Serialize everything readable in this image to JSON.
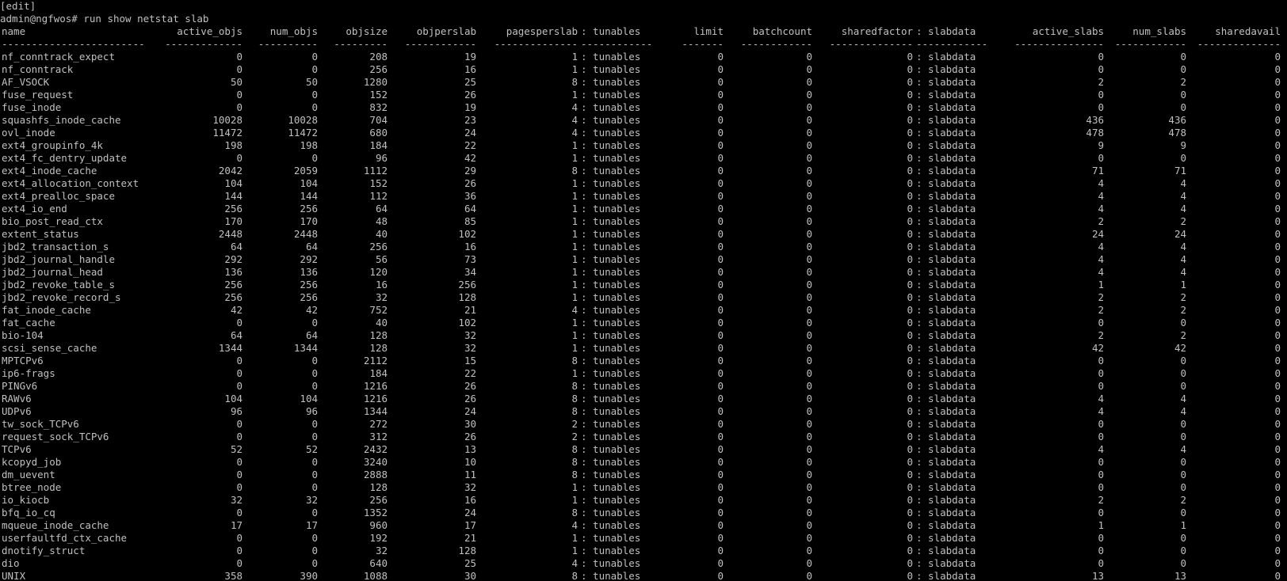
{
  "terminal": {
    "edit_line": "[edit]",
    "prompt": "admin@ngfwos#",
    "command": "run show netstat slab"
  },
  "table": {
    "headers": {
      "name": "name",
      "active_objs": "active_objs",
      "num_objs": "num_objs",
      "objsize": "objsize",
      "objperslab": "objperslab",
      "pagesperslab": "pagesperslab",
      "tunables": ": tunables",
      "limit": "limit",
      "batchcount": "batchcount",
      "sharedfactor": "sharedfactor",
      "slabdata": ": slabdata",
      "active_slabs": "active_slabs",
      "num_slabs": "num_slabs",
      "sharedavail": "sharedavail"
    },
    "separators": {
      "name": "------------------------",
      "active_objs": "-------------",
      "num_objs": "----------",
      "objsize": "---------",
      "objperslab": "------------",
      "pagesperslab": "--------------",
      "tunables": "------------",
      "limit": "-------",
      "batchcount": "------------",
      "sharedfactor": "--------------",
      "slabdata": "------------",
      "active_slabs": "---------------",
      "num_slabs": "------------",
      "sharedavail": "--------------"
    },
    "rows": [
      {
        "name": "nf_conntrack_expect",
        "active_objs": "0",
        "num_objs": "0",
        "objsize": "208",
        "objperslab": "19",
        "pagesperslab": "1",
        "tunables": ": tunables",
        "limit": "0",
        "batchcount": "0",
        "sharedfactor": "0",
        "slabdata": ": slabdata",
        "active_slabs": "0",
        "num_slabs": "0",
        "sharedavail": "0"
      },
      {
        "name": "nf_conntrack",
        "active_objs": "0",
        "num_objs": "0",
        "objsize": "256",
        "objperslab": "16",
        "pagesperslab": "1",
        "tunables": ": tunables",
        "limit": "0",
        "batchcount": "0",
        "sharedfactor": "0",
        "slabdata": ": slabdata",
        "active_slabs": "0",
        "num_slabs": "0",
        "sharedavail": "0"
      },
      {
        "name": "AF_VSOCK",
        "active_objs": "50",
        "num_objs": "50",
        "objsize": "1280",
        "objperslab": "25",
        "pagesperslab": "8",
        "tunables": ": tunables",
        "limit": "0",
        "batchcount": "0",
        "sharedfactor": "0",
        "slabdata": ": slabdata",
        "active_slabs": "2",
        "num_slabs": "2",
        "sharedavail": "0"
      },
      {
        "name": "fuse_request",
        "active_objs": "0",
        "num_objs": "0",
        "objsize": "152",
        "objperslab": "26",
        "pagesperslab": "1",
        "tunables": ": tunables",
        "limit": "0",
        "batchcount": "0",
        "sharedfactor": "0",
        "slabdata": ": slabdata",
        "active_slabs": "0",
        "num_slabs": "0",
        "sharedavail": "0"
      },
      {
        "name": "fuse_inode",
        "active_objs": "0",
        "num_objs": "0",
        "objsize": "832",
        "objperslab": "19",
        "pagesperslab": "4",
        "tunables": ": tunables",
        "limit": "0",
        "batchcount": "0",
        "sharedfactor": "0",
        "slabdata": ": slabdata",
        "active_slabs": "0",
        "num_slabs": "0",
        "sharedavail": "0"
      },
      {
        "name": "squashfs_inode_cache",
        "active_objs": "10028",
        "num_objs": "10028",
        "objsize": "704",
        "objperslab": "23",
        "pagesperslab": "4",
        "tunables": ": tunables",
        "limit": "0",
        "batchcount": "0",
        "sharedfactor": "0",
        "slabdata": ": slabdata",
        "active_slabs": "436",
        "num_slabs": "436",
        "sharedavail": "0"
      },
      {
        "name": "ovl_inode",
        "active_objs": "11472",
        "num_objs": "11472",
        "objsize": "680",
        "objperslab": "24",
        "pagesperslab": "4",
        "tunables": ": tunables",
        "limit": "0",
        "batchcount": "0",
        "sharedfactor": "0",
        "slabdata": ": slabdata",
        "active_slabs": "478",
        "num_slabs": "478",
        "sharedavail": "0"
      },
      {
        "name": "ext4_groupinfo_4k",
        "active_objs": "198",
        "num_objs": "198",
        "objsize": "184",
        "objperslab": "22",
        "pagesperslab": "1",
        "tunables": ": tunables",
        "limit": "0",
        "batchcount": "0",
        "sharedfactor": "0",
        "slabdata": ": slabdata",
        "active_slabs": "9",
        "num_slabs": "9",
        "sharedavail": "0"
      },
      {
        "name": "ext4_fc_dentry_update",
        "active_objs": "0",
        "num_objs": "0",
        "objsize": "96",
        "objperslab": "42",
        "pagesperslab": "1",
        "tunables": ": tunables",
        "limit": "0",
        "batchcount": "0",
        "sharedfactor": "0",
        "slabdata": ": slabdata",
        "active_slabs": "0",
        "num_slabs": "0",
        "sharedavail": "0"
      },
      {
        "name": "ext4_inode_cache",
        "active_objs": "2042",
        "num_objs": "2059",
        "objsize": "1112",
        "objperslab": "29",
        "pagesperslab": "8",
        "tunables": ": tunables",
        "limit": "0",
        "batchcount": "0",
        "sharedfactor": "0",
        "slabdata": ": slabdata",
        "active_slabs": "71",
        "num_slabs": "71",
        "sharedavail": "0"
      },
      {
        "name": "ext4_allocation_context",
        "active_objs": "104",
        "num_objs": "104",
        "objsize": "152",
        "objperslab": "26",
        "pagesperslab": "1",
        "tunables": ": tunables",
        "limit": "0",
        "batchcount": "0",
        "sharedfactor": "0",
        "slabdata": ": slabdata",
        "active_slabs": "4",
        "num_slabs": "4",
        "sharedavail": "0"
      },
      {
        "name": "ext4_prealloc_space",
        "active_objs": "144",
        "num_objs": "144",
        "objsize": "112",
        "objperslab": "36",
        "pagesperslab": "1",
        "tunables": ": tunables",
        "limit": "0",
        "batchcount": "0",
        "sharedfactor": "0",
        "slabdata": ": slabdata",
        "active_slabs": "4",
        "num_slabs": "4",
        "sharedavail": "0"
      },
      {
        "name": "ext4_io_end",
        "active_objs": "256",
        "num_objs": "256",
        "objsize": "64",
        "objperslab": "64",
        "pagesperslab": "1",
        "tunables": ": tunables",
        "limit": "0",
        "batchcount": "0",
        "sharedfactor": "0",
        "slabdata": ": slabdata",
        "active_slabs": "4",
        "num_slabs": "4",
        "sharedavail": "0"
      },
      {
        "name": "bio_post_read_ctx",
        "active_objs": "170",
        "num_objs": "170",
        "objsize": "48",
        "objperslab": "85",
        "pagesperslab": "1",
        "tunables": ": tunables",
        "limit": "0",
        "batchcount": "0",
        "sharedfactor": "0",
        "slabdata": ": slabdata",
        "active_slabs": "2",
        "num_slabs": "2",
        "sharedavail": "0"
      },
      {
        "name": "extent_status",
        "active_objs": "2448",
        "num_objs": "2448",
        "objsize": "40",
        "objperslab": "102",
        "pagesperslab": "1",
        "tunables": ": tunables",
        "limit": "0",
        "batchcount": "0",
        "sharedfactor": "0",
        "slabdata": ": slabdata",
        "active_slabs": "24",
        "num_slabs": "24",
        "sharedavail": "0"
      },
      {
        "name": "jbd2_transaction_s",
        "active_objs": "64",
        "num_objs": "64",
        "objsize": "256",
        "objperslab": "16",
        "pagesperslab": "1",
        "tunables": ": tunables",
        "limit": "0",
        "batchcount": "0",
        "sharedfactor": "0",
        "slabdata": ": slabdata",
        "active_slabs": "4",
        "num_slabs": "4",
        "sharedavail": "0"
      },
      {
        "name": "jbd2_journal_handle",
        "active_objs": "292",
        "num_objs": "292",
        "objsize": "56",
        "objperslab": "73",
        "pagesperslab": "1",
        "tunables": ": tunables",
        "limit": "0",
        "batchcount": "0",
        "sharedfactor": "0",
        "slabdata": ": slabdata",
        "active_slabs": "4",
        "num_slabs": "4",
        "sharedavail": "0"
      },
      {
        "name": "jbd2_journal_head",
        "active_objs": "136",
        "num_objs": "136",
        "objsize": "120",
        "objperslab": "34",
        "pagesperslab": "1",
        "tunables": ": tunables",
        "limit": "0",
        "batchcount": "0",
        "sharedfactor": "0",
        "slabdata": ": slabdata",
        "active_slabs": "4",
        "num_slabs": "4",
        "sharedavail": "0"
      },
      {
        "name": "jbd2_revoke_table_s",
        "active_objs": "256",
        "num_objs": "256",
        "objsize": "16",
        "objperslab": "256",
        "pagesperslab": "1",
        "tunables": ": tunables",
        "limit": "0",
        "batchcount": "0",
        "sharedfactor": "0",
        "slabdata": ": slabdata",
        "active_slabs": "1",
        "num_slabs": "1",
        "sharedavail": "0"
      },
      {
        "name": "jbd2_revoke_record_s",
        "active_objs": "256",
        "num_objs": "256",
        "objsize": "32",
        "objperslab": "128",
        "pagesperslab": "1",
        "tunables": ": tunables",
        "limit": "0",
        "batchcount": "0",
        "sharedfactor": "0",
        "slabdata": ": slabdata",
        "active_slabs": "2",
        "num_slabs": "2",
        "sharedavail": "0"
      },
      {
        "name": "fat_inode_cache",
        "active_objs": "42",
        "num_objs": "42",
        "objsize": "752",
        "objperslab": "21",
        "pagesperslab": "4",
        "tunables": ": tunables",
        "limit": "0",
        "batchcount": "0",
        "sharedfactor": "0",
        "slabdata": ": slabdata",
        "active_slabs": "2",
        "num_slabs": "2",
        "sharedavail": "0"
      },
      {
        "name": "fat_cache",
        "active_objs": "0",
        "num_objs": "0",
        "objsize": "40",
        "objperslab": "102",
        "pagesperslab": "1",
        "tunables": ": tunables",
        "limit": "0",
        "batchcount": "0",
        "sharedfactor": "0",
        "slabdata": ": slabdata",
        "active_slabs": "0",
        "num_slabs": "0",
        "sharedavail": "0"
      },
      {
        "name": "bio-104",
        "active_objs": "64",
        "num_objs": "64",
        "objsize": "128",
        "objperslab": "32",
        "pagesperslab": "1",
        "tunables": ": tunables",
        "limit": "0",
        "batchcount": "0",
        "sharedfactor": "0",
        "slabdata": ": slabdata",
        "active_slabs": "2",
        "num_slabs": "2",
        "sharedavail": "0"
      },
      {
        "name": "scsi_sense_cache",
        "active_objs": "1344",
        "num_objs": "1344",
        "objsize": "128",
        "objperslab": "32",
        "pagesperslab": "1",
        "tunables": ": tunables",
        "limit": "0",
        "batchcount": "0",
        "sharedfactor": "0",
        "slabdata": ": slabdata",
        "active_slabs": "42",
        "num_slabs": "42",
        "sharedavail": "0"
      },
      {
        "name": "MPTCPv6",
        "active_objs": "0",
        "num_objs": "0",
        "objsize": "2112",
        "objperslab": "15",
        "pagesperslab": "8",
        "tunables": ": tunables",
        "limit": "0",
        "batchcount": "0",
        "sharedfactor": "0",
        "slabdata": ": slabdata",
        "active_slabs": "0",
        "num_slabs": "0",
        "sharedavail": "0"
      },
      {
        "name": "ip6-frags",
        "active_objs": "0",
        "num_objs": "0",
        "objsize": "184",
        "objperslab": "22",
        "pagesperslab": "1",
        "tunables": ": tunables",
        "limit": "0",
        "batchcount": "0",
        "sharedfactor": "0",
        "slabdata": ": slabdata",
        "active_slabs": "0",
        "num_slabs": "0",
        "sharedavail": "0"
      },
      {
        "name": "PINGv6",
        "active_objs": "0",
        "num_objs": "0",
        "objsize": "1216",
        "objperslab": "26",
        "pagesperslab": "8",
        "tunables": ": tunables",
        "limit": "0",
        "batchcount": "0",
        "sharedfactor": "0",
        "slabdata": ": slabdata",
        "active_slabs": "0",
        "num_slabs": "0",
        "sharedavail": "0"
      },
      {
        "name": "RAWv6",
        "active_objs": "104",
        "num_objs": "104",
        "objsize": "1216",
        "objperslab": "26",
        "pagesperslab": "8",
        "tunables": ": tunables",
        "limit": "0",
        "batchcount": "0",
        "sharedfactor": "0",
        "slabdata": ": slabdata",
        "active_slabs": "4",
        "num_slabs": "4",
        "sharedavail": "0"
      },
      {
        "name": "UDPv6",
        "active_objs": "96",
        "num_objs": "96",
        "objsize": "1344",
        "objperslab": "24",
        "pagesperslab": "8",
        "tunables": ": tunables",
        "limit": "0",
        "batchcount": "0",
        "sharedfactor": "0",
        "slabdata": ": slabdata",
        "active_slabs": "4",
        "num_slabs": "4",
        "sharedavail": "0"
      },
      {
        "name": "tw_sock_TCPv6",
        "active_objs": "0",
        "num_objs": "0",
        "objsize": "272",
        "objperslab": "30",
        "pagesperslab": "2",
        "tunables": ": tunables",
        "limit": "0",
        "batchcount": "0",
        "sharedfactor": "0",
        "slabdata": ": slabdata",
        "active_slabs": "0",
        "num_slabs": "0",
        "sharedavail": "0"
      },
      {
        "name": "request_sock_TCPv6",
        "active_objs": "0",
        "num_objs": "0",
        "objsize": "312",
        "objperslab": "26",
        "pagesperslab": "2",
        "tunables": ": tunables",
        "limit": "0",
        "batchcount": "0",
        "sharedfactor": "0",
        "slabdata": ": slabdata",
        "active_slabs": "0",
        "num_slabs": "0",
        "sharedavail": "0"
      },
      {
        "name": "TCPv6",
        "active_objs": "52",
        "num_objs": "52",
        "objsize": "2432",
        "objperslab": "13",
        "pagesperslab": "8",
        "tunables": ": tunables",
        "limit": "0",
        "batchcount": "0",
        "sharedfactor": "0",
        "slabdata": ": slabdata",
        "active_slabs": "4",
        "num_slabs": "4",
        "sharedavail": "0"
      },
      {
        "name": "kcopyd_job",
        "active_objs": "0",
        "num_objs": "0",
        "objsize": "3240",
        "objperslab": "10",
        "pagesperslab": "8",
        "tunables": ": tunables",
        "limit": "0",
        "batchcount": "0",
        "sharedfactor": "0",
        "slabdata": ": slabdata",
        "active_slabs": "0",
        "num_slabs": "0",
        "sharedavail": "0"
      },
      {
        "name": "dm_uevent",
        "active_objs": "0",
        "num_objs": "0",
        "objsize": "2888",
        "objperslab": "11",
        "pagesperslab": "8",
        "tunables": ": tunables",
        "limit": "0",
        "batchcount": "0",
        "sharedfactor": "0",
        "slabdata": ": slabdata",
        "active_slabs": "0",
        "num_slabs": "0",
        "sharedavail": "0"
      },
      {
        "name": "btree_node",
        "active_objs": "0",
        "num_objs": "0",
        "objsize": "128",
        "objperslab": "32",
        "pagesperslab": "1",
        "tunables": ": tunables",
        "limit": "0",
        "batchcount": "0",
        "sharedfactor": "0",
        "slabdata": ": slabdata",
        "active_slabs": "0",
        "num_slabs": "0",
        "sharedavail": "0"
      },
      {
        "name": "io_kiocb",
        "active_objs": "32",
        "num_objs": "32",
        "objsize": "256",
        "objperslab": "16",
        "pagesperslab": "1",
        "tunables": ": tunables",
        "limit": "0",
        "batchcount": "0",
        "sharedfactor": "0",
        "slabdata": ": slabdata",
        "active_slabs": "2",
        "num_slabs": "2",
        "sharedavail": "0"
      },
      {
        "name": "bfq_io_cq",
        "active_objs": "0",
        "num_objs": "0",
        "objsize": "1352",
        "objperslab": "24",
        "pagesperslab": "8",
        "tunables": ": tunables",
        "limit": "0",
        "batchcount": "0",
        "sharedfactor": "0",
        "slabdata": ": slabdata",
        "active_slabs": "0",
        "num_slabs": "0",
        "sharedavail": "0"
      },
      {
        "name": "mqueue_inode_cache",
        "active_objs": "17",
        "num_objs": "17",
        "objsize": "960",
        "objperslab": "17",
        "pagesperslab": "4",
        "tunables": ": tunables",
        "limit": "0",
        "batchcount": "0",
        "sharedfactor": "0",
        "slabdata": ": slabdata",
        "active_slabs": "1",
        "num_slabs": "1",
        "sharedavail": "0"
      },
      {
        "name": "userfaultfd_ctx_cache",
        "active_objs": "0",
        "num_objs": "0",
        "objsize": "192",
        "objperslab": "21",
        "pagesperslab": "1",
        "tunables": ": tunables",
        "limit": "0",
        "batchcount": "0",
        "sharedfactor": "0",
        "slabdata": ": slabdata",
        "active_slabs": "0",
        "num_slabs": "0",
        "sharedavail": "0"
      },
      {
        "name": "dnotify_struct",
        "active_objs": "0",
        "num_objs": "0",
        "objsize": "32",
        "objperslab": "128",
        "pagesperslab": "1",
        "tunables": ": tunables",
        "limit": "0",
        "batchcount": "0",
        "sharedfactor": "0",
        "slabdata": ": slabdata",
        "active_slabs": "0",
        "num_slabs": "0",
        "sharedavail": "0"
      },
      {
        "name": "dio",
        "active_objs": "0",
        "num_objs": "0",
        "objsize": "640",
        "objperslab": "25",
        "pagesperslab": "4",
        "tunables": ": tunables",
        "limit": "0",
        "batchcount": "0",
        "sharedfactor": "0",
        "slabdata": ": slabdata",
        "active_slabs": "0",
        "num_slabs": "0",
        "sharedavail": "0"
      },
      {
        "name": "UNIX",
        "active_objs": "358",
        "num_objs": "390",
        "objsize": "1088",
        "objperslab": "30",
        "pagesperslab": "8",
        "tunables": ": tunables",
        "limit": "0",
        "batchcount": "0",
        "sharedfactor": "0",
        "slabdata": ": slabdata",
        "active_slabs": "13",
        "num_slabs": "13",
        "sharedavail": "0"
      }
    ]
  }
}
